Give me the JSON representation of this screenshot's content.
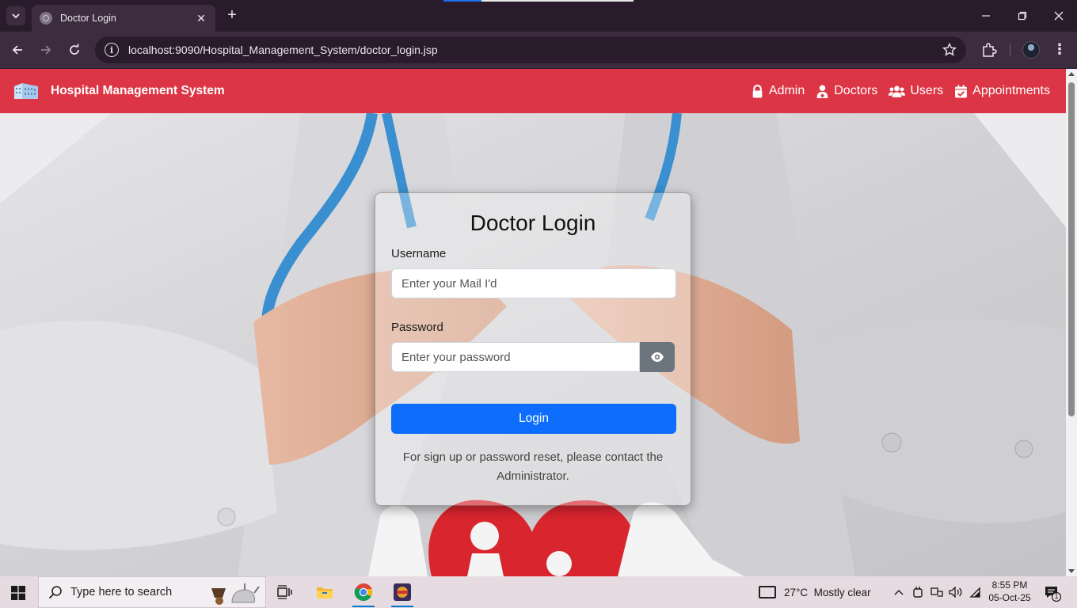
{
  "browser": {
    "tab_title": "Doctor Login",
    "url": "localhost:9090/Hospital_Management_System/doctor_login.jsp"
  },
  "navbar": {
    "brand": "Hospital Management System",
    "links": [
      {
        "label": "Admin",
        "icon": "lock-icon"
      },
      {
        "label": "Doctors",
        "icon": "user-doctor-icon"
      },
      {
        "label": "Users",
        "icon": "users-icon"
      },
      {
        "label": "Appointments",
        "icon": "calendar-check-icon"
      }
    ]
  },
  "login": {
    "title": "Doctor Login",
    "username_label": "Username",
    "username_placeholder": "Enter your Mail I'd",
    "password_label": "Password",
    "password_placeholder": "Enter your password",
    "login_button": "Login",
    "note": "For sign up or password reset, please contact the Administrator."
  },
  "taskbar": {
    "search_placeholder": "Type here to search",
    "weather": "27°C  Mostly clear",
    "time": "8:55 PM",
    "date": "05-Oct-25",
    "notification_count": "1"
  },
  "colors": {
    "navbar": "#dc3545",
    "login_button": "#0d6efd",
    "eye_button": "#6c757d",
    "browser_frame": "#3d2c40"
  }
}
